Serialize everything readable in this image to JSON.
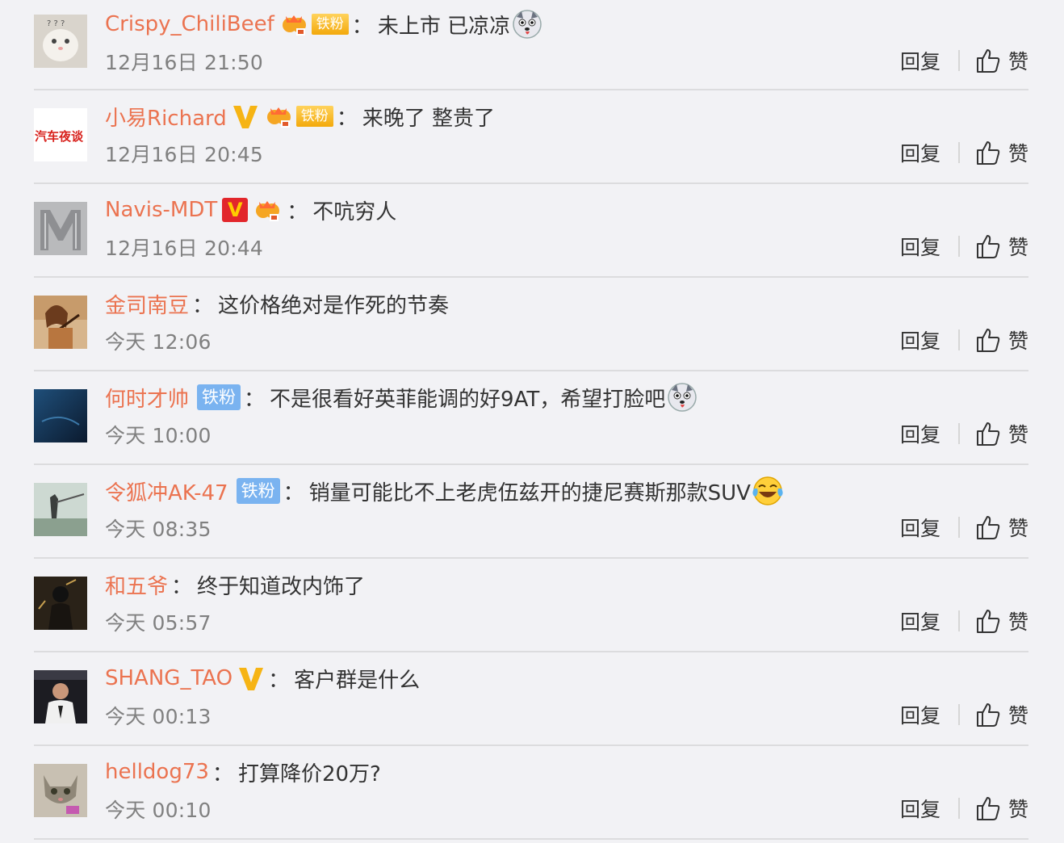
{
  "actions": {
    "reply_label": "回复",
    "like_label": "赞"
  },
  "comments": [
    {
      "username": "Crispy_ChiliBeef",
      "fan_label": "铁粉",
      "colon": "：",
      "text": "未上市 已凉凉",
      "time": "12月16日 21:50"
    },
    {
      "username": "小易Richard",
      "fan_label": "铁粉",
      "colon": "：",
      "text": "来晚了 整贵了",
      "time": "12月16日 20:45",
      "avatar_text": "汽车夜谈"
    },
    {
      "username": "Navis-MDT",
      "colon": "：",
      "text": "不吭穷人",
      "time": "12月16日 20:44"
    },
    {
      "username": "金司南豆",
      "colon": "：",
      "text": "这价格绝对是作死的节奏",
      "time": "今天 12:06"
    },
    {
      "username": "何时才帅",
      "fan_label": "铁粉",
      "colon": "：",
      "text": "不是很看好英菲能调的好9AT，希望打脸吧",
      "time": "今天 10:00"
    },
    {
      "username": "令狐冲AK-47",
      "fan_label": "铁粉",
      "colon": "：",
      "text": "销量可能比不上老虎伍兹开的捷尼赛斯那款SUV",
      "time": "今天 08:35"
    },
    {
      "username": "和五爷",
      "colon": "：",
      "text": "终于知道改内饰了",
      "time": "今天 05:57"
    },
    {
      "username": "SHANG_TAO",
      "colon": "：",
      "text": "客户群是什么",
      "time": "今天 00:13"
    },
    {
      "username": "helldog73",
      "colon": "：",
      "text": "打算降价20万?",
      "time": "今天 00:10"
    }
  ],
  "colors": {
    "username": "#eb7350",
    "text": "#333333",
    "time": "#808080",
    "bg": "#f2f2f5"
  }
}
